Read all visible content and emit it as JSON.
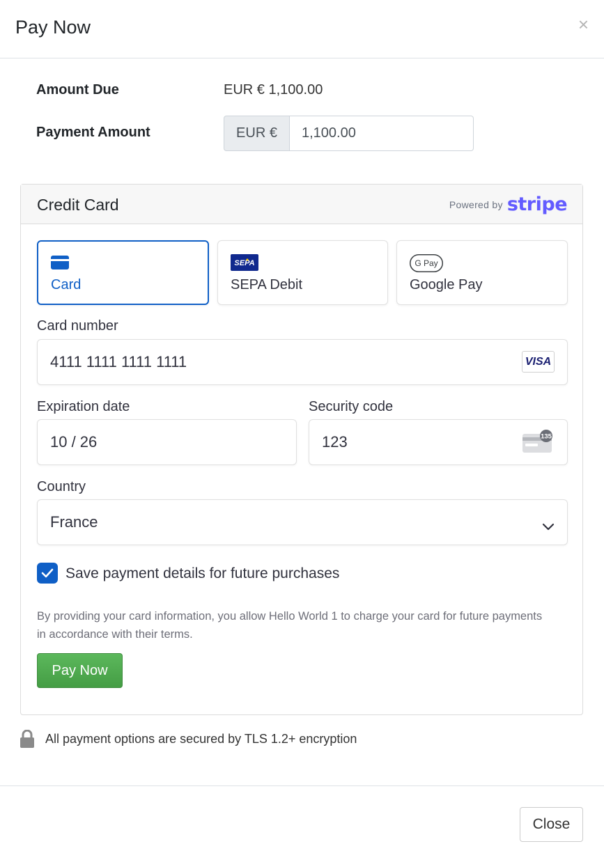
{
  "modal": {
    "title": "Pay Now",
    "close_glyph": "×"
  },
  "amount_due": {
    "label": "Amount Due",
    "value": "EUR € 1,100.00"
  },
  "payment_amount": {
    "label": "Payment Amount",
    "currency_addon": "EUR €",
    "value": "1,100.00"
  },
  "card_panel": {
    "title": "Credit Card",
    "powered_by": "Powered by",
    "brand": "stripe"
  },
  "methods": [
    {
      "label": "Card",
      "icon": "card-icon",
      "active": true
    },
    {
      "label": "SEPA Debit",
      "icon": "sepa-icon",
      "icon_text": "SEPA",
      "active": false
    },
    {
      "label": "Google Pay",
      "icon": "google-pay-icon",
      "icon_text": "G Pay",
      "active": false
    }
  ],
  "card_number": {
    "label": "Card number",
    "value": "4111 1111 1111 1111",
    "brand_badge": "VISA"
  },
  "expiration": {
    "label": "Expiration date",
    "value": "10 / 26"
  },
  "security": {
    "label": "Security code",
    "value": "123",
    "cvc_hint": "135"
  },
  "country": {
    "label": "Country",
    "value": "France"
  },
  "save_details": {
    "label": "Save payment details for future purchases",
    "checked": true
  },
  "terms": "By providing your card information, you allow Hello World 1 to charge your card for future payments in accordance with their terms.",
  "pay_button": "Pay Now",
  "secure_note": "All payment options are secured by TLS 1.2+ encryption",
  "footer": {
    "close_button": "Close"
  },
  "colors": {
    "accent": "#0f5fc6",
    "stripe": "#635bff",
    "success": "#5cb85c"
  }
}
